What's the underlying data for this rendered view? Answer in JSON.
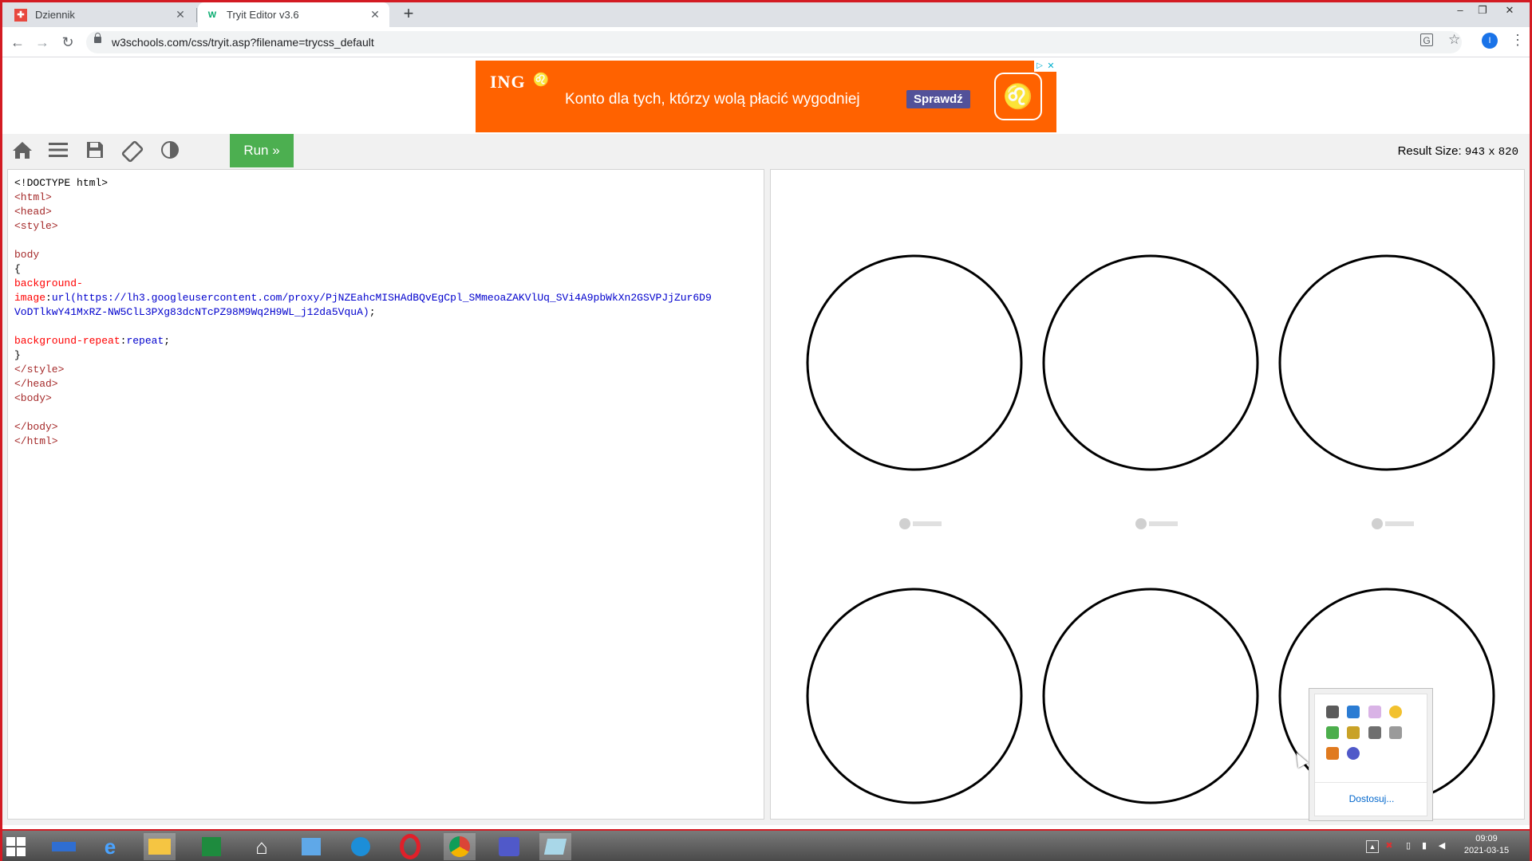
{
  "browser": {
    "tabs": [
      {
        "title": "Dziennik",
        "favicon": "dziennik-icon",
        "active": false
      },
      {
        "title": "Tryit Editor v3.6",
        "favicon": "w3schools-icon",
        "active": true
      }
    ],
    "url": "w3schools.com/css/tryit.asp?filename=trycss_default",
    "profile_initial": "I"
  },
  "ad": {
    "brand": "ING",
    "headline": "Konto dla tych, którzy wolą płacić wygodniej",
    "cta": "Sprawdź",
    "background": "#ff6200"
  },
  "toolbar": {
    "icons": [
      "home-icon",
      "menu-icon",
      "save-icon",
      "rotate-icon",
      "contrast-icon"
    ],
    "run_label": "Run »",
    "result_size_label": "Result Size:",
    "result_width": "943",
    "result_x": "x",
    "result_height": "820"
  },
  "editor": {
    "lines": [
      [
        {
          "t": "<!DOCTYPE html>",
          "c": "blk"
        }
      ],
      [
        {
          "t": "<html>",
          "c": "tag"
        }
      ],
      [
        {
          "t": "<head>",
          "c": "tag"
        }
      ],
      [
        {
          "t": "<style>",
          "c": "tag"
        }
      ],
      [],
      [
        {
          "t": "body",
          "c": "tag"
        }
      ],
      [
        {
          "t": "{",
          "c": "blk"
        }
      ],
      [
        {
          "t": "background-",
          "c": "prop"
        }
      ],
      [
        {
          "t": "image",
          "c": "prop"
        },
        {
          "t": ":",
          "c": "blk"
        },
        {
          "t": "url(https://lh3.googleusercontent.com/proxy/PjNZEahcMISHAdBQvEgCpl_SMmeoaZAKVlUq_SVi4A9pbWkXn2GSVPJjZur6D9",
          "c": "pval"
        }
      ],
      [
        {
          "t": "VoDTlkwY41MxRZ-NW5ClL3PXg83dcNTcPZ98M9Wq2H9WL_j12da5VquA)",
          "c": "pval"
        },
        {
          "t": ";",
          "c": "blk"
        }
      ],
      [],
      [
        {
          "t": "background-repeat",
          "c": "prop"
        },
        {
          "t": ":",
          "c": "blk"
        },
        {
          "t": "repeat",
          "c": "pval"
        },
        {
          "t": ";",
          "c": "blk"
        }
      ],
      [
        {
          "t": "}",
          "c": "blk"
        }
      ],
      [
        {
          "t": "</style>",
          "c": "tag"
        }
      ],
      [
        {
          "t": "</head>",
          "c": "tag"
        }
      ],
      [
        {
          "t": "<body>",
          "c": "tag"
        }
      ],
      [],
      [
        {
          "t": "</body>",
          "c": "tag"
        }
      ],
      [
        {
          "t": "</html>",
          "c": "tag"
        }
      ]
    ]
  },
  "tray_popup": {
    "icons": [
      "display-icon",
      "network-icon",
      "paint-icon",
      "green-circle-icon",
      "shield-check-icon",
      "package-icon",
      "camera-icon",
      "printer-icon",
      "orange-app-icon",
      "teams-icon"
    ],
    "link": "Dostosuj..."
  },
  "taskbar": {
    "apps": [
      "lenovo-icon",
      "monitor-icon",
      "ie-icon",
      "file-explorer-icon",
      "store-icon",
      "home-icon",
      "mail-icon",
      "edge-icon",
      "opera-icon",
      "chrome-icon",
      "teams-icon",
      "notepad-icon"
    ],
    "time": "09:09",
    "date": "2021-03-15"
  }
}
